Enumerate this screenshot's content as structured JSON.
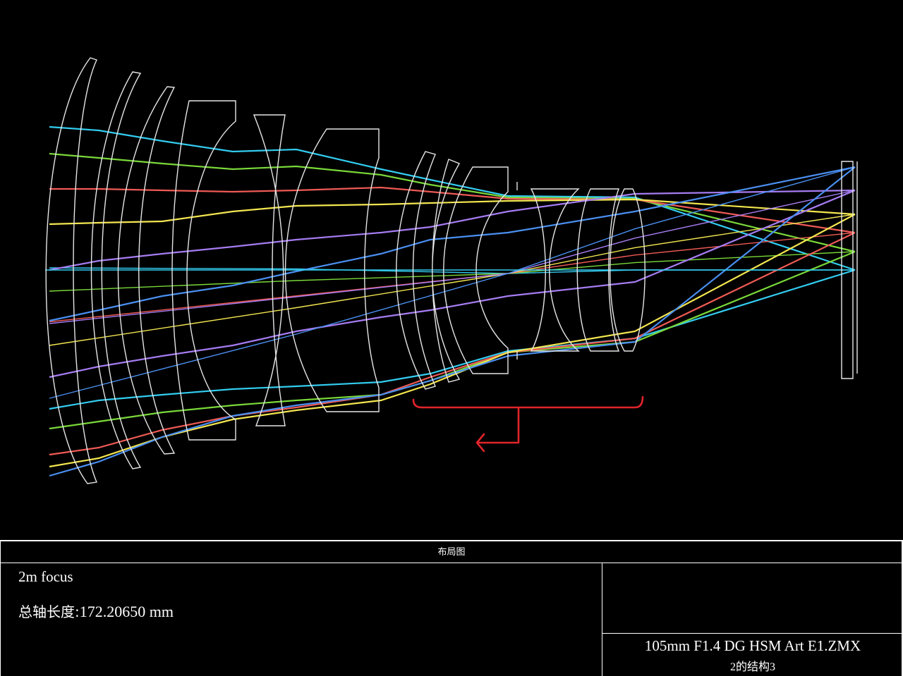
{
  "layout_title": "布局图",
  "note": "2m focus",
  "total_length_label": "总轴长度:",
  "total_length_value": "172.20650 mm",
  "file_name": "105mm F1.4 DG HSM Art E1.ZMX",
  "config_label": "2的结构3",
  "colors": {
    "background": "#000000",
    "lens": "#e6e6e6",
    "annotation": "#e0242b",
    "field_rays": [
      "#33ccf0",
      "#7ad83a",
      "#ee5a55",
      "#f3e650",
      "#a67cf2",
      "#4a8ff0"
    ]
  }
}
